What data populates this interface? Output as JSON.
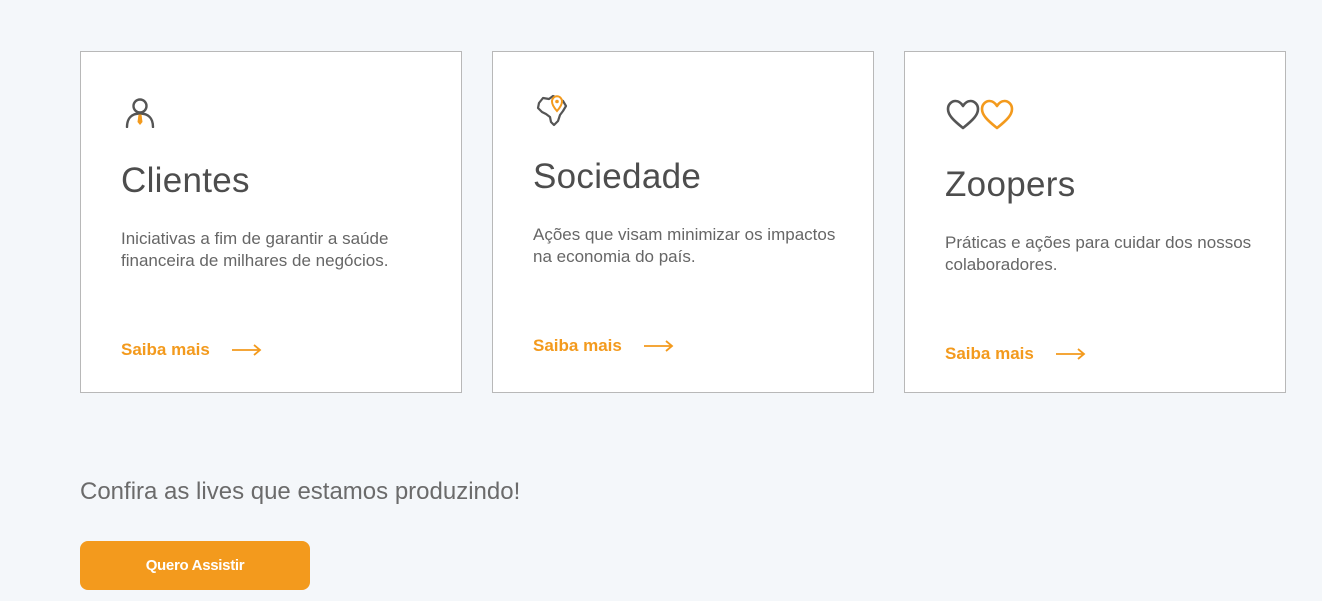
{
  "colors": {
    "accent": "#f39a1d",
    "background": "#f4f7fa",
    "card_border": "#b8b8b8",
    "title_text": "#4d4d4d",
    "body_text": "#666666"
  },
  "cards": [
    {
      "icon": "person-icon",
      "title": "Clientes",
      "description": "Iniciativas a fim de garantir a saúde financeira de milhares de negócios.",
      "link_label": "Saiba mais"
    },
    {
      "icon": "brazil-map-pin-icon",
      "title": "Sociedade",
      "description": "Ações que visam minimizar os impactos na economia do país.",
      "link_label": "Saiba mais"
    },
    {
      "icon": "two-hearts-icon",
      "title": "Zoopers",
      "description": "Práticas e ações para cuidar dos nossos colaboradores.",
      "link_label": "Saiba mais"
    }
  ],
  "lives": {
    "heading": "Confira as lives que estamos produzindo!",
    "button_label": "Quero Assistir"
  }
}
